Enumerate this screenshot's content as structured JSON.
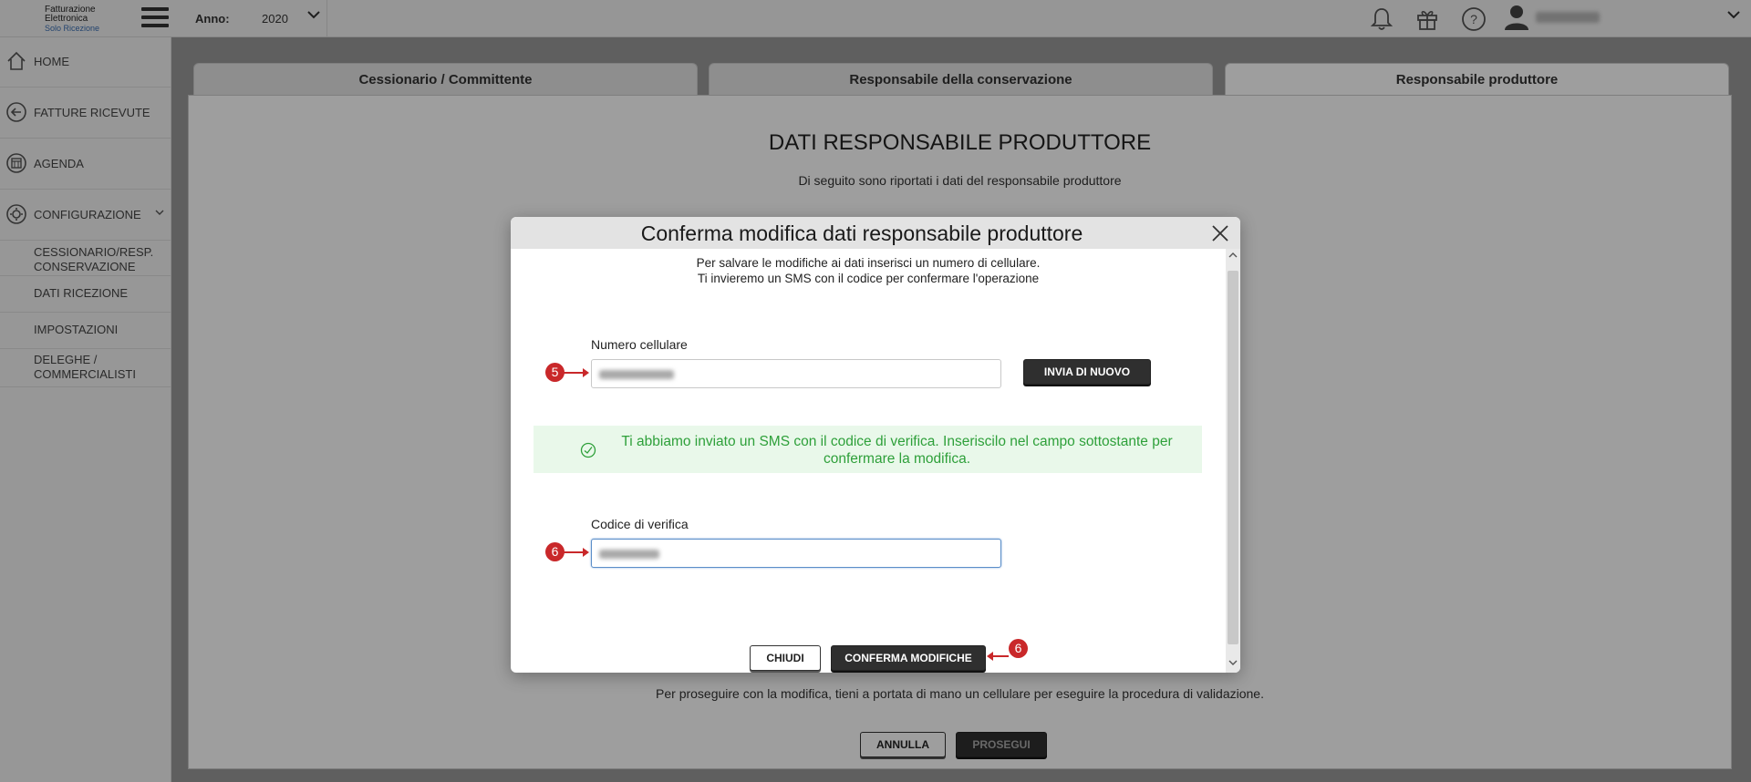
{
  "logo": {
    "line1": "Fatturazione",
    "line2": "Elettronica",
    "line3": "Solo Ricezione"
  },
  "topbar": {
    "year_label": "Anno:",
    "year_value": "2020",
    "icons": [
      "bell-icon",
      "gift-icon",
      "help-icon",
      "user-icon"
    ]
  },
  "sidebar": {
    "items": [
      {
        "label": "HOME",
        "icon": "home-icon"
      },
      {
        "label": "FATTURE RICEVUTE",
        "icon": "arrow-left-circle-icon"
      },
      {
        "label": "AGENDA",
        "icon": "calendar-icon"
      },
      {
        "label": "CONFIGURAZIONE",
        "icon": "gear-icon"
      }
    ],
    "subitems": [
      "CESSIONARIO/RESP. CONSERVAZIONE",
      "DATI RICEZIONE",
      "IMPOSTAZIONI",
      "DELEGHE / COMMERCIALISTI"
    ]
  },
  "tabs": [
    {
      "label": "Cessionario / Committente",
      "active": false
    },
    {
      "label": "Responsabile della conservazione",
      "active": false
    },
    {
      "label": "Responsabile produttore",
      "active": true
    }
  ],
  "panel": {
    "title": "DATI RESPONSABILE PRODUTTORE",
    "subtitle": "Di seguito sono riportati i dati del responsabile produttore",
    "note": "Per proseguire con la modifica, tieni a portata di mano un cellulare per eseguire la procedura di validazione.",
    "cancel_label": "ANNULLA",
    "proceed_label": "PROSEGUI"
  },
  "modal": {
    "title": "Conferma modifica dati responsabile produttore",
    "intro_line1": "Per salvare le modifiche ai dati inserisci un numero di cellulare.",
    "intro_line2": "Ti invieremo un SMS con il codice per confermare l'operazione",
    "phone_label": "Numero cellulare",
    "resend_label": "INVIA DI NUOVO",
    "alert_text": "Ti abbiamo inviato un SMS con il codice di verifica. Inseriscilo nel campo sottostante per confermare la modifica.",
    "code_label": "Codice di verifica",
    "close_label": "CHIUDI",
    "confirm_label": "CONFERMA MODIFICHE"
  },
  "markers": {
    "phone": "5",
    "code": "6",
    "confirm": "6"
  },
  "colors": {
    "marker": "#c9282a",
    "alert_text": "#2ea03a",
    "alert_bg": "#e9f8ea",
    "dark_button": "#2f2f2f"
  }
}
